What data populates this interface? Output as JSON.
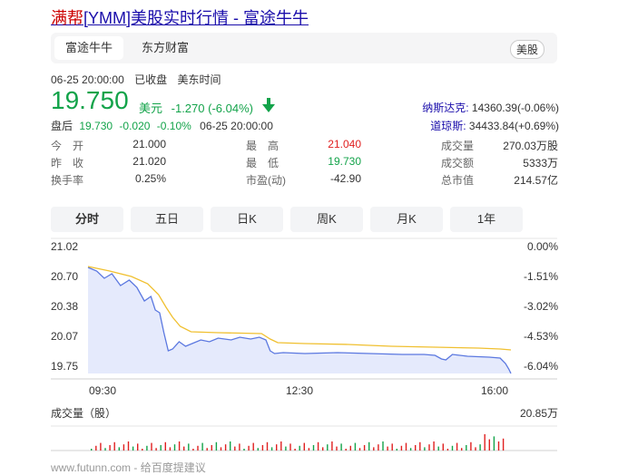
{
  "header": {
    "title_highlight": "满帮",
    "title_rest": "[YMM]美股实时行情 - 富途牛牛"
  },
  "tabs": {
    "items": [
      "富途牛牛",
      "东方财富"
    ],
    "market_badge": "美股"
  },
  "quote": {
    "datetime": "06-25 20:00:00",
    "status": "已收盘",
    "timezone": "美东时间",
    "price": "19.750",
    "currency": "美元",
    "change": "-1.270 (-6.04%)",
    "after_label": "盘后",
    "after_price": "19.730",
    "after_change": "-0.020",
    "after_pct": "-0.10%",
    "after_time": "06-25 20:00:00"
  },
  "indices": [
    {
      "name": "纳斯达克:",
      "value": "14360.39(-0.06%)"
    },
    {
      "name": "道琼斯:",
      "value": "34433.84(+0.69%)"
    }
  ],
  "stats": [
    [
      {
        "label": "今　开",
        "value": "21.000"
      },
      {
        "label": "最　高",
        "value": "21.040"
      },
      {
        "label": "成交量",
        "value": "270.03万股"
      }
    ],
    [
      {
        "label": "昨　收",
        "value": "21.020"
      },
      {
        "label": "最　低",
        "value": "19.730"
      },
      {
        "label": "成交额",
        "value": "5333万"
      }
    ],
    [
      {
        "label": "换手率",
        "value": "0.25%"
      },
      {
        "label": "市盈(动)",
        "value": "-42.90"
      },
      {
        "label": "总市值",
        "value": "214.57亿"
      }
    ]
  ],
  "periods": [
    "分时",
    "五日",
    "日K",
    "周K",
    "月K",
    "1年"
  ],
  "chart_data": {
    "type": "line",
    "y_left_ticks": [
      "21.02",
      "20.70",
      "20.38",
      "20.07",
      "19.75"
    ],
    "y_right_ticks": [
      "0.00%",
      "-1.51%",
      "-3.02%",
      "-4.53%",
      "-6.04%"
    ],
    "x_ticks": [
      "09:30",
      "12:30",
      "16:00"
    ],
    "ylim": [
      19.75,
      21.02
    ],
    "xlim_minutes": [
      0,
      390
    ],
    "series": [
      {
        "color": "#5b78e0",
        "points": [
          [
            0,
            20.92
          ],
          [
            8,
            20.88
          ],
          [
            15,
            20.8
          ],
          [
            22,
            20.85
          ],
          [
            30,
            20.72
          ],
          [
            38,
            20.78
          ],
          [
            45,
            20.7
          ],
          [
            52,
            20.55
          ],
          [
            58,
            20.6
          ],
          [
            62,
            20.45
          ],
          [
            66,
            20.42
          ],
          [
            70,
            20.2
          ],
          [
            74,
            20.0
          ],
          [
            78,
            20.02
          ],
          [
            84,
            20.1
          ],
          [
            90,
            20.05
          ],
          [
            96,
            20.08
          ],
          [
            104,
            20.12
          ],
          [
            112,
            20.1
          ],
          [
            120,
            20.14
          ],
          [
            132,
            20.12
          ],
          [
            140,
            20.15
          ],
          [
            150,
            20.13
          ],
          [
            158,
            20.15
          ],
          [
            164,
            20.12
          ],
          [
            168,
            20.0
          ],
          [
            172,
            19.97
          ],
          [
            180,
            19.98
          ],
          [
            200,
            19.97
          ],
          [
            230,
            19.98
          ],
          [
            260,
            19.97
          ],
          [
            290,
            19.96
          ],
          [
            310,
            19.96
          ],
          [
            320,
            19.95
          ],
          [
            326,
            19.91
          ],
          [
            330,
            19.9
          ],
          [
            336,
            19.96
          ],
          [
            350,
            19.94
          ],
          [
            370,
            19.93
          ],
          [
            380,
            19.92
          ],
          [
            385,
            19.86
          ],
          [
            388,
            19.8
          ],
          [
            390,
            19.75
          ]
        ]
      },
      {
        "color": "#f0c030",
        "points": [
          [
            0,
            20.93
          ],
          [
            20,
            20.88
          ],
          [
            40,
            20.82
          ],
          [
            55,
            20.74
          ],
          [
            65,
            20.62
          ],
          [
            72,
            20.48
          ],
          [
            78,
            20.37
          ],
          [
            85,
            20.27
          ],
          [
            95,
            20.21
          ],
          [
            120,
            20.2
          ],
          [
            160,
            20.19
          ],
          [
            168,
            20.13
          ],
          [
            175,
            20.09
          ],
          [
            200,
            20.08
          ],
          [
            240,
            20.07
          ],
          [
            280,
            20.05
          ],
          [
            320,
            20.04
          ],
          [
            360,
            20.03
          ],
          [
            380,
            20.02
          ],
          [
            390,
            20.01
          ]
        ]
      }
    ]
  },
  "volume": {
    "label": "成交量（股）",
    "max": "20.85万"
  },
  "footer": {
    "text": "www.futunn.com - 给百度提建议"
  }
}
